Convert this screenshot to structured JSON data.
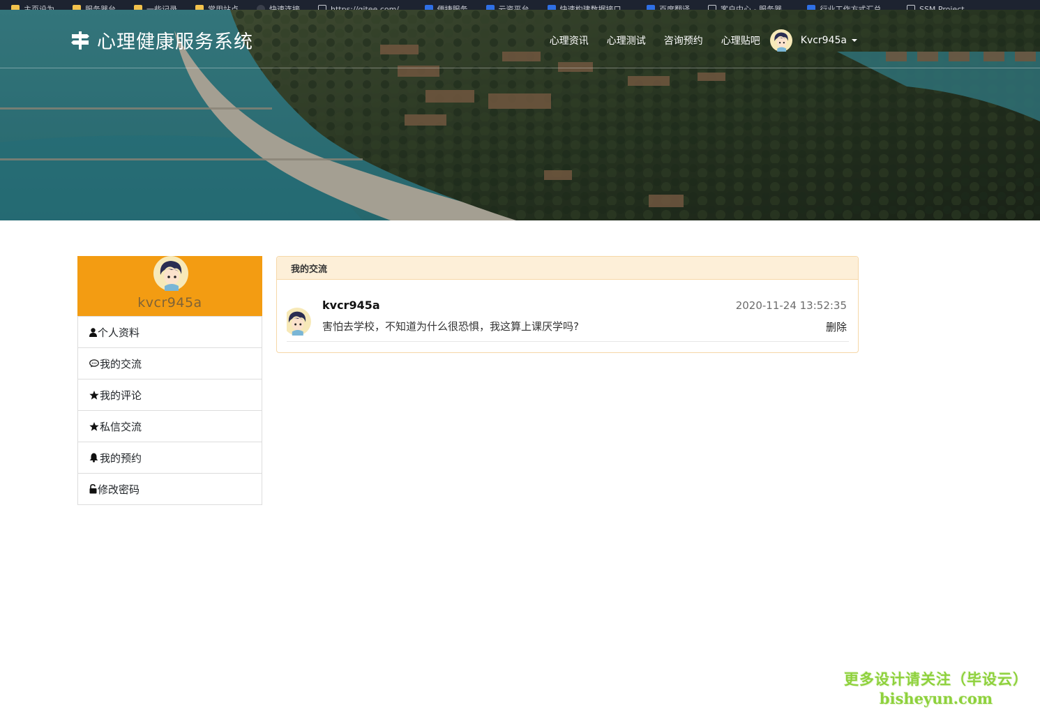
{
  "browser": {
    "bookmarks": [
      {
        "label": "主页设为",
        "icon": "folder-icon"
      },
      {
        "label": "服务器台",
        "icon": "folder-icon"
      },
      {
        "label": "一些记录",
        "icon": "folder-icon"
      },
      {
        "label": "常用站点",
        "icon": "folder-icon"
      },
      {
        "label": "快速连接",
        "icon": "github-icon"
      },
      {
        "label": "https://gitee.com/...",
        "icon": "page-icon"
      },
      {
        "label": "便捷服务",
        "icon": "app-icon"
      },
      {
        "label": "云资平台",
        "icon": "app-icon"
      },
      {
        "label": "快速构建数据接口...",
        "icon": "app-icon"
      },
      {
        "label": "百度翻译",
        "icon": "app-icon"
      },
      {
        "label": "客户中心 - 服务器...",
        "icon": "page-icon"
      },
      {
        "label": "行业工作方式汇总...",
        "icon": "app-icon"
      },
      {
        "label": "SSM Project ...",
        "icon": "page-icon"
      }
    ]
  },
  "header": {
    "brand": "心理健康服务系统",
    "nav": [
      "心理资讯",
      "心理测试",
      "咨询预约",
      "心理贴吧"
    ],
    "user_label": "Kvcr945a"
  },
  "sidebar": {
    "username": "kvcr945a",
    "items": [
      {
        "label": "个人资料",
        "icon": "user-icon"
      },
      {
        "label": "我的交流",
        "icon": "comment-icon"
      },
      {
        "label": "我的评论",
        "icon": "star-icon"
      },
      {
        "label": "私信交流",
        "icon": "star-icon"
      },
      {
        "label": "我的预约",
        "icon": "bell-icon"
      },
      {
        "label": "修改密码",
        "icon": "unlock-icon"
      }
    ]
  },
  "panel": {
    "title": "我的交流",
    "posts": [
      {
        "author": "kvcr945a",
        "time": "2020-11-24 13:52:35",
        "content": "害怕去学校，不知道为什么很恐惧，我这算上课厌学吗?",
        "delete_label": "删除"
      }
    ]
  },
  "watermark": {
    "line1": "更多设计请关注（毕设云）",
    "line2": "bisheyun.com"
  },
  "colors": {
    "accent": "#f39c12",
    "panel_header": "#fdefd8",
    "panel_border": "#f6d7a7"
  }
}
